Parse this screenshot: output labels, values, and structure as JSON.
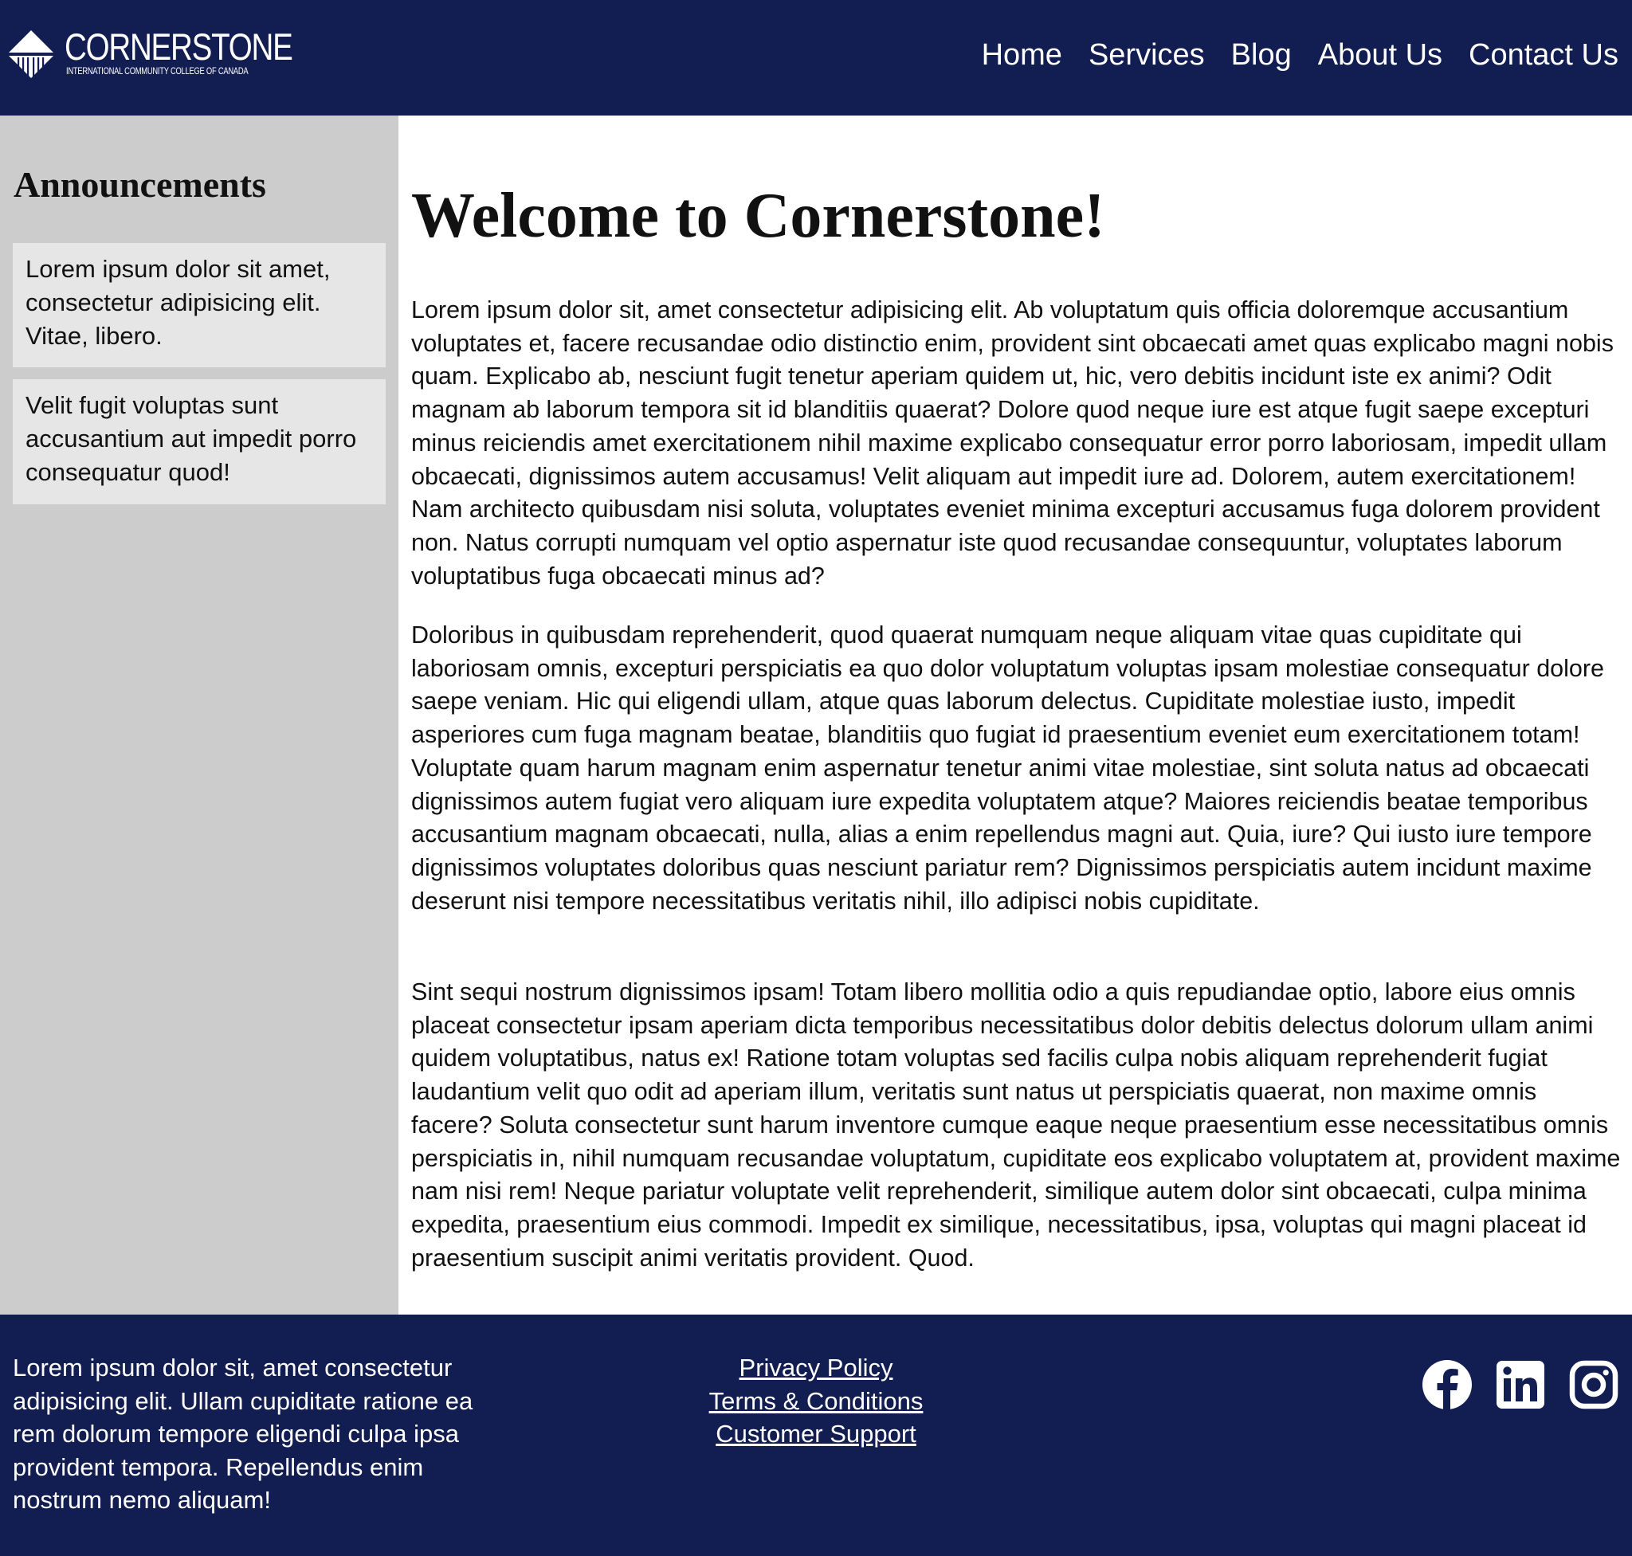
{
  "header": {
    "logo": {
      "name": "CORNERSTONE",
      "tagline": "INTERNATIONAL COMMUNITY COLLEGE OF CANADA"
    },
    "nav": [
      {
        "label": "Home"
      },
      {
        "label": "Services"
      },
      {
        "label": "Blog"
      },
      {
        "label": "About Us"
      },
      {
        "label": "Contact Us"
      }
    ]
  },
  "sidebar": {
    "title": "Announcements",
    "items": [
      {
        "text": "Lorem ipsum dolor sit amet, consectetur adipisicing elit. Vitae, libero."
      },
      {
        "text": "Velit fugit voluptas sunt accusantium aut impedit porro consequatur quod!"
      }
    ]
  },
  "main": {
    "title": "Welcome to Cornerstone!",
    "paragraphs": [
      "Lorem ipsum dolor sit, amet consectetur adipisicing elit. Ab voluptatum quis officia doloremque accusantium voluptates et, facere recusandae odio distinctio enim, provident sint obcaecati amet quas explicabo magni nobis quam. Explicabo ab, nesciunt fugit tenetur aperiam quidem ut, hic, vero debitis incidunt iste ex animi? Odit magnam ab laborum tempora sit id blanditiis quaerat? Dolore quod neque iure est atque fugit saepe excepturi minus reiciendis amet exercitationem nihil maxime explicabo consequatur error porro laboriosam, impedit ullam obcaecati, dignissimos autem accusamus! Velit aliquam aut impedit iure ad. Dolorem, autem exercitationem! Nam architecto quibusdam nisi soluta, voluptates eveniet minima excepturi accusamus fuga dolorem provident non. Natus corrupti numquam vel optio aspernatur iste quod recusandae consequuntur, voluptates laborum voluptatibus fuga obcaecati minus ad?",
      "Doloribus in quibusdam reprehenderit, quod quaerat numquam neque aliquam vitae quas cupiditate qui laboriosam omnis, excepturi perspiciatis ea quo dolor voluptatum voluptas ipsam molestiae consequatur dolore saepe veniam. Hic qui eligendi ullam, atque quas laborum delectus. Cupiditate molestiae iusto, impedit asperiores cum fuga magnam beatae, blanditiis quo fugiat id praesentium eveniet eum exercitationem totam! Voluptate quam harum magnam enim aspernatur tenetur animi vitae molestiae, sint soluta natus ad obcaecati dignissimos autem fugiat vero aliquam iure expedita voluptatem atque? Maiores reiciendis beatae temporibus accusantium magnam obcaecati, nulla, alias a enim repellendus magni aut. Quia, iure? Qui iusto iure tempore dignissimos voluptates doloribus quas nesciunt pariatur rem? Dignissimos perspiciatis autem incidunt maxime deserunt nisi tempore necessitatibus veritatis nihil, illo adipisci nobis cupiditate.",
      "Sint sequi nostrum dignissimos ipsam! Totam libero mollitia odio a quis repudiandae optio, labore eius omnis placeat consectetur ipsam aperiam dicta temporibus necessitatibus dolor debitis delectus dolorum ullam animi quidem voluptatibus, natus ex! Ratione totam voluptas sed facilis culpa nobis aliquam reprehenderit fugiat laudantium velit quo odit ad aperiam illum, veritatis sunt natus ut perspiciatis quaerat, non maxime omnis facere? Soluta consectetur sunt harum inventore cumque eaque neque praesentium esse necessitatibus omnis perspiciatis in, nihil numquam recusandae voluptatum, cupiditate eos explicabo voluptatem at, provident maxime nam nisi rem! Neque pariatur voluptate velit reprehenderit, similique autem dolor sint obcaecati, culpa minima expedita, praesentium eius commodi. Impedit ex similique, necessitatibus, ipsa, voluptas qui magni placeat id praesentium suscipit animi veritatis provident. Quod."
    ]
  },
  "footer": {
    "text": "Lorem ipsum dolor sit, amet consectetur adipisicing elit. Ullam cupiditate ratione ea rem dolorum tempore eligendi culpa ipsa provident tempora. Repellendus enim nostrum nemo aliquam!",
    "links": [
      {
        "label": "Privacy Policy"
      },
      {
        "label": "Terms & Conditions"
      },
      {
        "label": "Customer Support"
      }
    ],
    "social": [
      {
        "icon": "facebook-icon"
      },
      {
        "icon": "linkedin-icon"
      },
      {
        "icon": "instagram-icon"
      }
    ]
  },
  "colors": {
    "navy": "#121d52",
    "sidebar_bg": "#cccccc",
    "announcement_bg": "#e6e6e6",
    "text": "#111111",
    "white": "#ffffff"
  }
}
